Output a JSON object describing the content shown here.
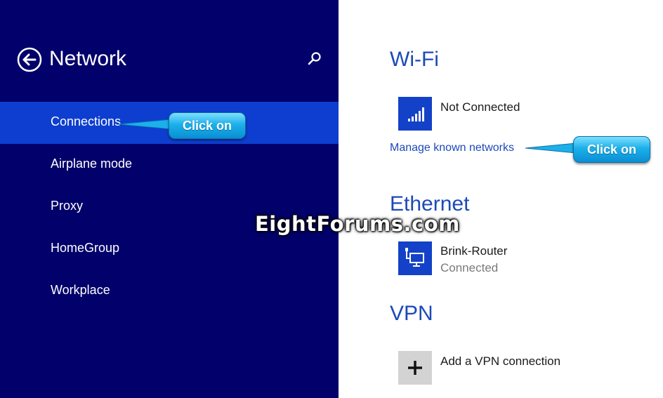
{
  "left_pane": {
    "title": "Network",
    "back_icon": "back-arrow-circle-icon",
    "search_icon": "search-icon",
    "nav_items": [
      {
        "label": "Connections",
        "selected": true
      },
      {
        "label": "Airplane mode",
        "selected": false
      },
      {
        "label": "Proxy",
        "selected": false
      },
      {
        "label": "HomeGroup",
        "selected": false
      },
      {
        "label": "Workplace",
        "selected": false
      }
    ],
    "bg_color": "#02006b",
    "selected_color": "#0d3ecf"
  },
  "right_pane": {
    "wifi": {
      "heading": "Wi-Fi",
      "network_name": "Not Connected",
      "icon": "wifi-signal-icon",
      "manage_link": "Manage known networks"
    },
    "ethernet": {
      "heading": "Ethernet",
      "network_name": "Brink-Router",
      "status": "Connected",
      "icon": "ethernet-computer-icon"
    },
    "vpn": {
      "heading": "VPN",
      "add_label": "Add a VPN connection",
      "icon": "plus-icon"
    },
    "accent_color": "#1d49b8"
  },
  "annotations": {
    "callout_connections": "Click on",
    "callout_manage": "Click on",
    "watermark": "EightForums.com"
  }
}
